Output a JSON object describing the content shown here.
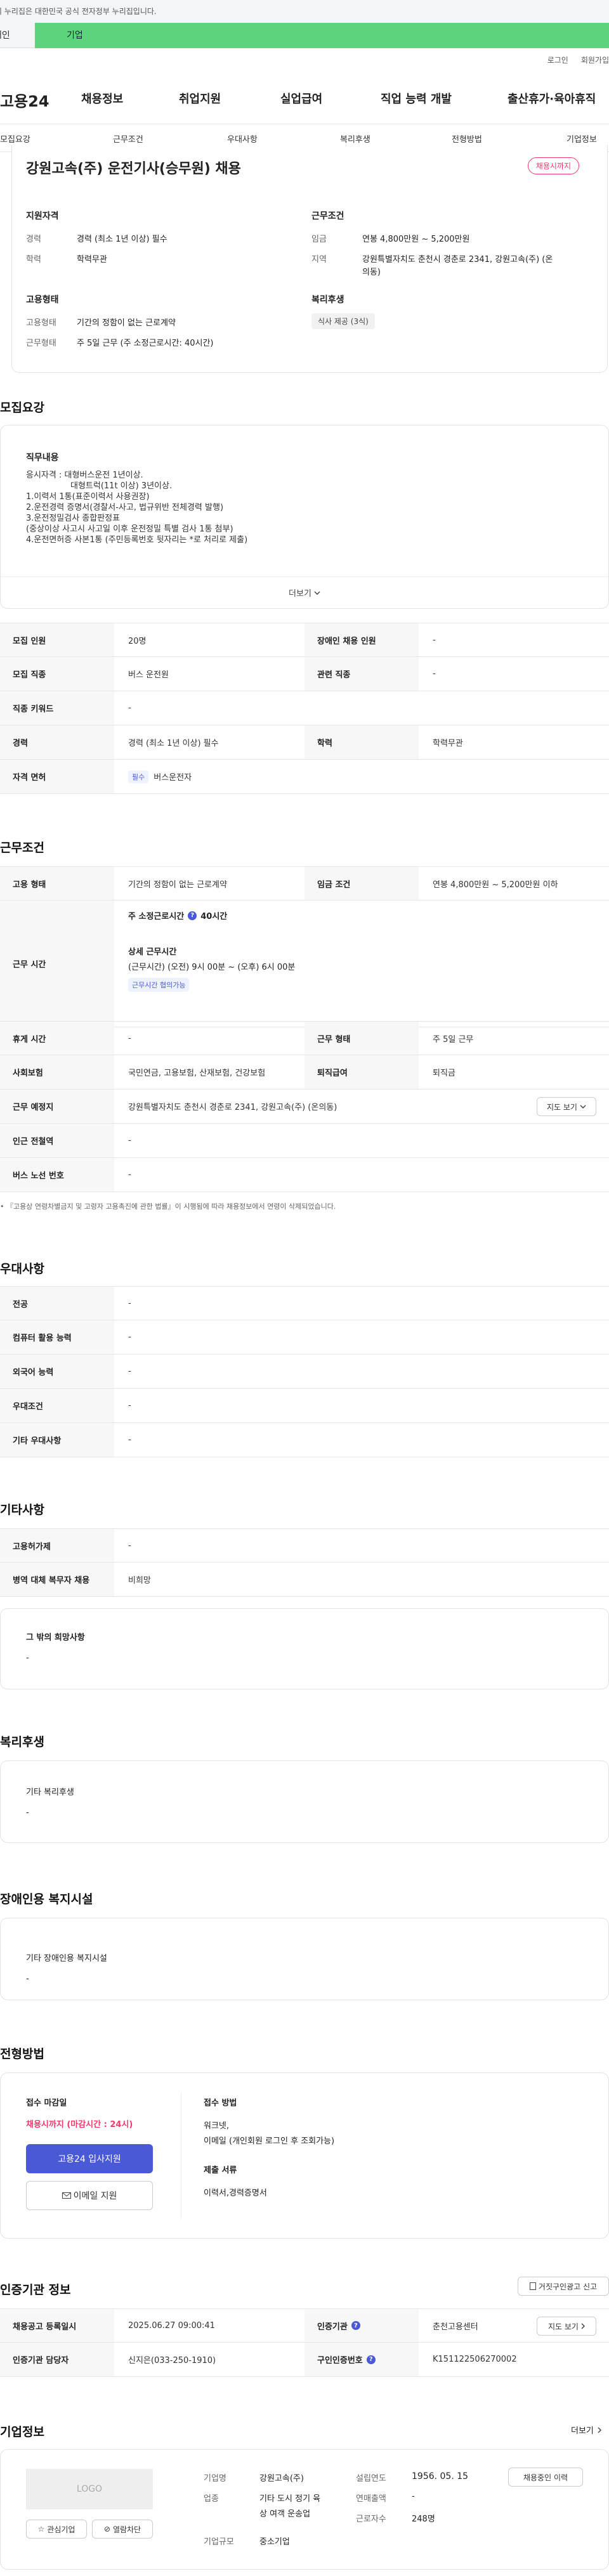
{
  "banner": {
    "text": "이 누리집은 대한민국 공식 전자정부 누리집입니다.",
    "tab_personal": "개인",
    "tab_company": "기업"
  },
  "util": {
    "login": "로그인",
    "signup": "회원가입"
  },
  "gnb": {
    "logo": "고용24",
    "items": [
      "채용정보",
      "취업지원",
      "실업급여",
      "직업 능력 개발",
      "출산휴가·육아휴직"
    ]
  },
  "lnb": {
    "items": [
      "모집요강",
      "근무조건",
      "우대사항",
      "복리후생",
      "전형방법",
      "기업정보"
    ]
  },
  "job": {
    "title": "강원고속(주) 운전기사(승무원) 채용",
    "status": "채용시까지",
    "qual_title": "지원자격",
    "career_label": "경력",
    "career_value": "경력 (최소 1년 이상) 필수",
    "edu_label": "학력",
    "edu_value": "학력무관",
    "cond_title": "근무조건",
    "wage_label": "임금",
    "wage_value": "연봉 4,800만원 ~ 5,200만원",
    "region_label": "지역",
    "region_value_1": "강원특별자치도 춘천시 경춘로 2341, 강원고속(주) (온",
    "region_value_2": "의동)",
    "emp_title": "고용형태",
    "emp_label": "고용형태",
    "emp_value": "기간의 정함이 없는 근로계약",
    "work_label": "근무형태",
    "work_value": "주 5일 근무 (주 소정근로시간: 40시간)",
    "welfare_title": "복리후생",
    "welfare_tag": "식사 제공 (3식)"
  },
  "recruit": {
    "section_title": "모집요강",
    "duty_title": "직무내용",
    "lines": [
      "응시자격 : 대형버스운전 1년이상.",
      "대형트럭(11t 이상) 3년이상.",
      "",
      "",
      "1.이력서 1통(표준이력서 사용권장)",
      "2.운전경력 증명서(경찰서-사고, 법규위반 전체경력 발행)",
      "3.운전정밀검사 종합판정표",
      "(중상이상 사고시 사고일 이후 운전정밀 특별 검사 1통 첨부)",
      "4.운전면허증 사본1통 (주민등록번호 뒷자리는 *로 처리로 제출)"
    ],
    "more": "더보기",
    "rows": [
      {
        "h1": "모집 인원",
        "v1": "20명",
        "h2": "장애인 채용 인원",
        "v2": "-"
      },
      {
        "h1": "모집 직종",
        "v1": "버스 운전원",
        "h2": "관련 직종",
        "v2": "-"
      },
      {
        "h1": "직종 키워드",
        "v1": "-"
      },
      {
        "h1": "경력",
        "v1": "경력 (최소 1년 이상) 필수",
        "h2": "학력",
        "v2": "학력무관"
      },
      {
        "h1": "자격 면허",
        "badge": "필수",
        "v1": "버스운전자"
      }
    ]
  },
  "work": {
    "section_title": "근무조건",
    "emp_h": "고용 형태",
    "emp_v": "기간의 정함이 없는 근로계약",
    "wage_h": "임금 조건",
    "wage_v": "연봉 4,800만원 ~ 5,200만원 이하",
    "time_h": "근무 시간",
    "weekly": "주 소정근로시간",
    "weekly_v": "40시간",
    "detail": "상세 근무시간",
    "detail_v": "(근무시간) (오전) 9시 00분 ~ (오후) 6시 00분",
    "negotiable": "근무시간 협의가능",
    "rest_h": "휴게 시간",
    "rest_v": "-",
    "shift_h": "근무 형태",
    "shift_v": "주 5일 근무",
    "ins_h": "사회보험",
    "ins_v": "국민연금, 고용보험, 산재보험, 건강보험",
    "ret_h": "퇴직급여",
    "ret_v": "퇴직금",
    "place_h": "근무 예정지",
    "place_v": "강원특별자치도 춘천시 경춘로 2341, 강원고속(주) (온의동)",
    "map_btn": "지도 보기",
    "subway_h": "인근 전철역",
    "subway_v": "-",
    "bus_h": "버스 노선 번호",
    "bus_v": "-",
    "note": "『고용상 연령차별금지 및 고령자 고용촉진에 관한 법률』이 시행됨에 따라 채용정보에서 연령이 삭제되었습니다."
  },
  "pref": {
    "section_title": "우대사항",
    "rows": [
      [
        "전공",
        "-"
      ],
      [
        "컴퓨터 활용 능력",
        "-"
      ],
      [
        "외국어 능력",
        "-"
      ],
      [
        "우대조건",
        "-"
      ],
      [
        "기타 우대사항",
        "-"
      ]
    ]
  },
  "etc": {
    "section_title": "기타사항",
    "rows": [
      [
        "고용허가제",
        "-"
      ],
      [
        "병역 대체 복무자 채용",
        "비희망"
      ]
    ],
    "hope_title": "그 밖의 희망사항",
    "hope_v": "-"
  },
  "welfare": {
    "section_title": "복리후생",
    "box_title": "기타 복리후생",
    "box_v": "-"
  },
  "disab": {
    "section_title": "장애인용 복지시설",
    "box_title": "기타 장애인용 복지시설",
    "box_v": "-"
  },
  "apply": {
    "section_title": "전형방법",
    "deadline_title": "접수 마감일",
    "deadline_v": "채용시까지 (마감시간 : 24시)",
    "apply_btn": "고용24 입사지원",
    "email_btn": "이메일 지원",
    "method_title": "접수 방법",
    "method_v1": "워크넷,",
    "method_v2": "이메일 (개인회원 로그인 후 조회가능)",
    "docs_title": "제출 서류",
    "docs_v": "이력서,경력증명서"
  },
  "cert": {
    "section_title": "인증기관 정보",
    "report_btn": "거짓구인광고 신고",
    "reg_h": "채용공고 등록일시",
    "reg_v": "2025.06.27 09:00:41",
    "org_h": "인증기관",
    "org_v": "춘천고용센터",
    "map_btn": "지도 보기",
    "mgr_h": "인증기관 담당자",
    "mgr_v": "신지은(033-250-1910)",
    "no_h": "구인인증번호",
    "no_v": "K151122506270002"
  },
  "company": {
    "section_title": "기업정보",
    "more": "더보기",
    "logo": "LOGO",
    "fav_btn": "관심기업",
    "block_btn": "열람차단",
    "name_h": "기업명",
    "name_v": "강원고속(주)",
    "founded_h": "설립연도",
    "founded_v": "1956. 05. 15",
    "biz_h": "업종",
    "biz_v1": "기타 도시 정기 육",
    "biz_v2": "상 여객 운송업",
    "sales_h": "연매출액",
    "sales_v": "-",
    "emp_h": "근로자수",
    "emp_v": "248명",
    "size_h": "기업규모",
    "size_v": "중소기업",
    "jobs_btn": "채용중인 이력"
  },
  "colors": {
    "accent": "#5dd37c",
    "pink": "#f03a6b",
    "blue": "#4a5ad6"
  }
}
